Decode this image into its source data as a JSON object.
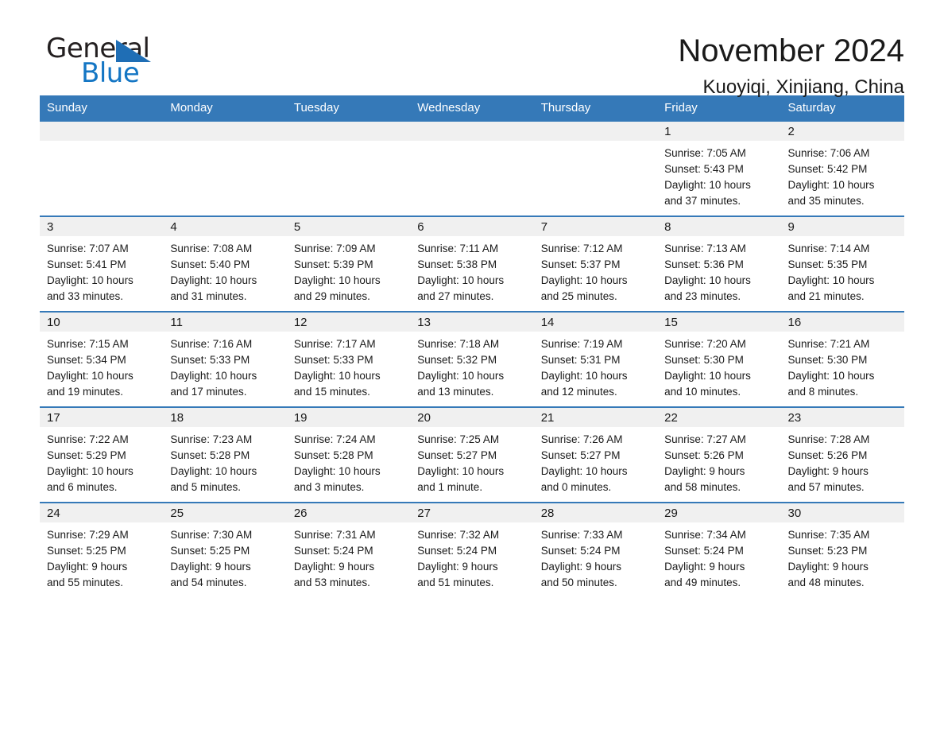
{
  "brand": {
    "name_top": "General",
    "name_bottom": "Blue",
    "accent_color": "#1476c4",
    "triangle_color": "#1f6eb5"
  },
  "header": {
    "month_title": "November 2024",
    "location": "Kuoyiqi, Xinjiang, China"
  },
  "calendar": {
    "header_bg": "#3579b8",
    "daynum_bg": "#f0f0f0",
    "weekday_headers": [
      "Sunday",
      "Monday",
      "Tuesday",
      "Wednesday",
      "Thursday",
      "Friday",
      "Saturday"
    ],
    "weeks": [
      [
        {
          "day": "",
          "sunrise": "",
          "sunset": "",
          "daylight_line1": "",
          "daylight_line2": ""
        },
        {
          "day": "",
          "sunrise": "",
          "sunset": "",
          "daylight_line1": "",
          "daylight_line2": ""
        },
        {
          "day": "",
          "sunrise": "",
          "sunset": "",
          "daylight_line1": "",
          "daylight_line2": ""
        },
        {
          "day": "",
          "sunrise": "",
          "sunset": "",
          "daylight_line1": "",
          "daylight_line2": ""
        },
        {
          "day": "",
          "sunrise": "",
          "sunset": "",
          "daylight_line1": "",
          "daylight_line2": ""
        },
        {
          "day": "1",
          "sunrise": "Sunrise: 7:05 AM",
          "sunset": "Sunset: 5:43 PM",
          "daylight_line1": "Daylight: 10 hours",
          "daylight_line2": "and 37 minutes."
        },
        {
          "day": "2",
          "sunrise": "Sunrise: 7:06 AM",
          "sunset": "Sunset: 5:42 PM",
          "daylight_line1": "Daylight: 10 hours",
          "daylight_line2": "and 35 minutes."
        }
      ],
      [
        {
          "day": "3",
          "sunrise": "Sunrise: 7:07 AM",
          "sunset": "Sunset: 5:41 PM",
          "daylight_line1": "Daylight: 10 hours",
          "daylight_line2": "and 33 minutes."
        },
        {
          "day": "4",
          "sunrise": "Sunrise: 7:08 AM",
          "sunset": "Sunset: 5:40 PM",
          "daylight_line1": "Daylight: 10 hours",
          "daylight_line2": "and 31 minutes."
        },
        {
          "day": "5",
          "sunrise": "Sunrise: 7:09 AM",
          "sunset": "Sunset: 5:39 PM",
          "daylight_line1": "Daylight: 10 hours",
          "daylight_line2": "and 29 minutes."
        },
        {
          "day": "6",
          "sunrise": "Sunrise: 7:11 AM",
          "sunset": "Sunset: 5:38 PM",
          "daylight_line1": "Daylight: 10 hours",
          "daylight_line2": "and 27 minutes."
        },
        {
          "day": "7",
          "sunrise": "Sunrise: 7:12 AM",
          "sunset": "Sunset: 5:37 PM",
          "daylight_line1": "Daylight: 10 hours",
          "daylight_line2": "and 25 minutes."
        },
        {
          "day": "8",
          "sunrise": "Sunrise: 7:13 AM",
          "sunset": "Sunset: 5:36 PM",
          "daylight_line1": "Daylight: 10 hours",
          "daylight_line2": "and 23 minutes."
        },
        {
          "day": "9",
          "sunrise": "Sunrise: 7:14 AM",
          "sunset": "Sunset: 5:35 PM",
          "daylight_line1": "Daylight: 10 hours",
          "daylight_line2": "and 21 minutes."
        }
      ],
      [
        {
          "day": "10",
          "sunrise": "Sunrise: 7:15 AM",
          "sunset": "Sunset: 5:34 PM",
          "daylight_line1": "Daylight: 10 hours",
          "daylight_line2": "and 19 minutes."
        },
        {
          "day": "11",
          "sunrise": "Sunrise: 7:16 AM",
          "sunset": "Sunset: 5:33 PM",
          "daylight_line1": "Daylight: 10 hours",
          "daylight_line2": "and 17 minutes."
        },
        {
          "day": "12",
          "sunrise": "Sunrise: 7:17 AM",
          "sunset": "Sunset: 5:33 PM",
          "daylight_line1": "Daylight: 10 hours",
          "daylight_line2": "and 15 minutes."
        },
        {
          "day": "13",
          "sunrise": "Sunrise: 7:18 AM",
          "sunset": "Sunset: 5:32 PM",
          "daylight_line1": "Daylight: 10 hours",
          "daylight_line2": "and 13 minutes."
        },
        {
          "day": "14",
          "sunrise": "Sunrise: 7:19 AM",
          "sunset": "Sunset: 5:31 PM",
          "daylight_line1": "Daylight: 10 hours",
          "daylight_line2": "and 12 minutes."
        },
        {
          "day": "15",
          "sunrise": "Sunrise: 7:20 AM",
          "sunset": "Sunset: 5:30 PM",
          "daylight_line1": "Daylight: 10 hours",
          "daylight_line2": "and 10 minutes."
        },
        {
          "day": "16",
          "sunrise": "Sunrise: 7:21 AM",
          "sunset": "Sunset: 5:30 PM",
          "daylight_line1": "Daylight: 10 hours",
          "daylight_line2": "and 8 minutes."
        }
      ],
      [
        {
          "day": "17",
          "sunrise": "Sunrise: 7:22 AM",
          "sunset": "Sunset: 5:29 PM",
          "daylight_line1": "Daylight: 10 hours",
          "daylight_line2": "and 6 minutes."
        },
        {
          "day": "18",
          "sunrise": "Sunrise: 7:23 AM",
          "sunset": "Sunset: 5:28 PM",
          "daylight_line1": "Daylight: 10 hours",
          "daylight_line2": "and 5 minutes."
        },
        {
          "day": "19",
          "sunrise": "Sunrise: 7:24 AM",
          "sunset": "Sunset: 5:28 PM",
          "daylight_line1": "Daylight: 10 hours",
          "daylight_line2": "and 3 minutes."
        },
        {
          "day": "20",
          "sunrise": "Sunrise: 7:25 AM",
          "sunset": "Sunset: 5:27 PM",
          "daylight_line1": "Daylight: 10 hours",
          "daylight_line2": "and 1 minute."
        },
        {
          "day": "21",
          "sunrise": "Sunrise: 7:26 AM",
          "sunset": "Sunset: 5:27 PM",
          "daylight_line1": "Daylight: 10 hours",
          "daylight_line2": "and 0 minutes."
        },
        {
          "day": "22",
          "sunrise": "Sunrise: 7:27 AM",
          "sunset": "Sunset: 5:26 PM",
          "daylight_line1": "Daylight: 9 hours",
          "daylight_line2": "and 58 minutes."
        },
        {
          "day": "23",
          "sunrise": "Sunrise: 7:28 AM",
          "sunset": "Sunset: 5:26 PM",
          "daylight_line1": "Daylight: 9 hours",
          "daylight_line2": "and 57 minutes."
        }
      ],
      [
        {
          "day": "24",
          "sunrise": "Sunrise: 7:29 AM",
          "sunset": "Sunset: 5:25 PM",
          "daylight_line1": "Daylight: 9 hours",
          "daylight_line2": "and 55 minutes."
        },
        {
          "day": "25",
          "sunrise": "Sunrise: 7:30 AM",
          "sunset": "Sunset: 5:25 PM",
          "daylight_line1": "Daylight: 9 hours",
          "daylight_line2": "and 54 minutes."
        },
        {
          "day": "26",
          "sunrise": "Sunrise: 7:31 AM",
          "sunset": "Sunset: 5:24 PM",
          "daylight_line1": "Daylight: 9 hours",
          "daylight_line2": "and 53 minutes."
        },
        {
          "day": "27",
          "sunrise": "Sunrise: 7:32 AM",
          "sunset": "Sunset: 5:24 PM",
          "daylight_line1": "Daylight: 9 hours",
          "daylight_line2": "and 51 minutes."
        },
        {
          "day": "28",
          "sunrise": "Sunrise: 7:33 AM",
          "sunset": "Sunset: 5:24 PM",
          "daylight_line1": "Daylight: 9 hours",
          "daylight_line2": "and 50 minutes."
        },
        {
          "day": "29",
          "sunrise": "Sunrise: 7:34 AM",
          "sunset": "Sunset: 5:24 PM",
          "daylight_line1": "Daylight: 9 hours",
          "daylight_line2": "and 49 minutes."
        },
        {
          "day": "30",
          "sunrise": "Sunrise: 7:35 AM",
          "sunset": "Sunset: 5:23 PM",
          "daylight_line1": "Daylight: 9 hours",
          "daylight_line2": "and 48 minutes."
        }
      ]
    ]
  }
}
